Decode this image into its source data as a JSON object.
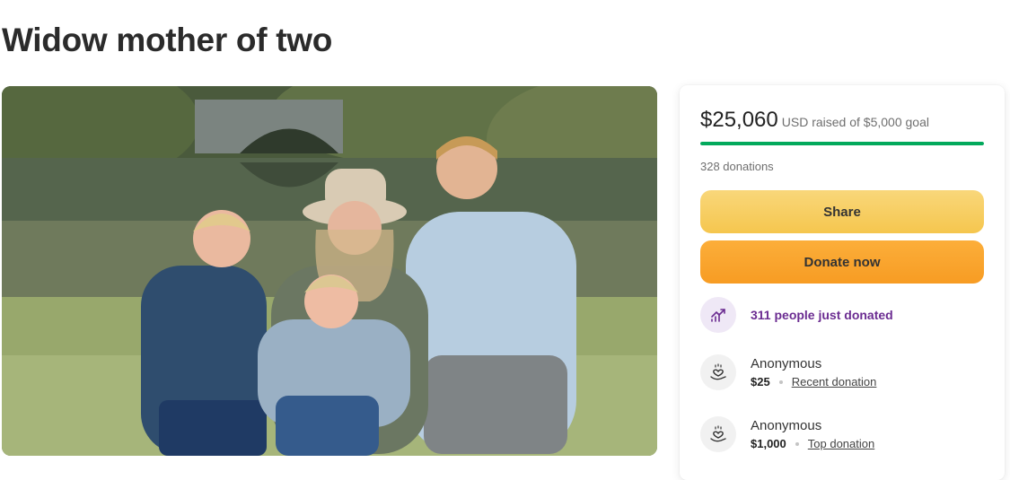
{
  "page": {
    "title": "Widow mother of two"
  },
  "fundraiser": {
    "amount_raised": "$25,060",
    "raised_suffix": "USD raised of $5,000 goal",
    "progress_fraction": 1.0,
    "donations_count": "328 donations",
    "share_label": "Share",
    "donate_label": "Donate now",
    "trend_text": "311 people just donated"
  },
  "donations": [
    {
      "name": "Anonymous",
      "amount": "$25",
      "tag": "Recent donation"
    },
    {
      "name": "Anonymous",
      "amount": "$1,000",
      "tag": "Top donation"
    }
  ],
  "icons": {
    "trend": "trending-up-icon",
    "donation": "heart-hand-icon"
  },
  "colors": {
    "progress": "#02a95c",
    "share_button": "#f5c64e",
    "donate_button": "#f79c23",
    "trend_text": "#6b2c91"
  }
}
